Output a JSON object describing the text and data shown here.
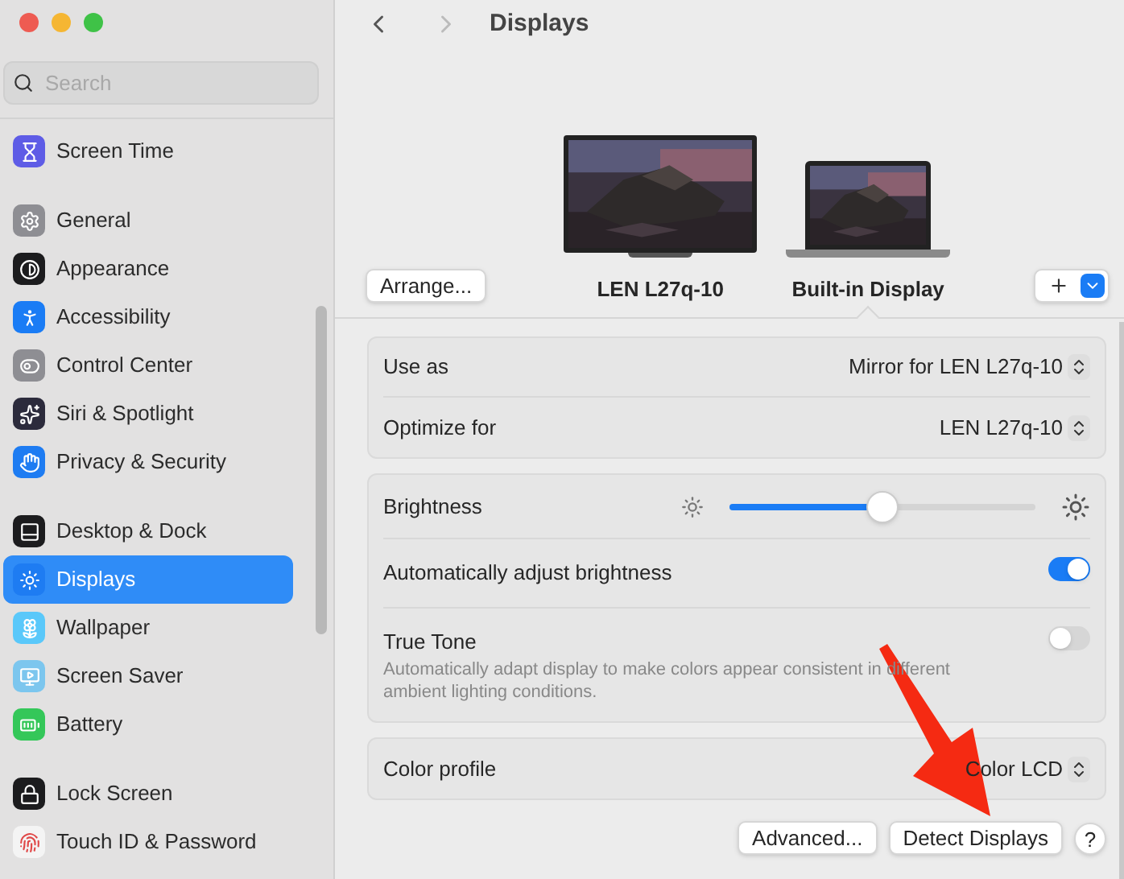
{
  "search": {
    "placeholder": "Search"
  },
  "sidebar": {
    "groups": [
      {
        "items": [
          {
            "label": "Screen Time",
            "color": "#5e5ce6",
            "selected": false
          }
        ]
      },
      {
        "items": [
          {
            "label": "General",
            "color": "#8e8e93",
            "selected": false
          },
          {
            "label": "Appearance",
            "color": "#1c1c1e",
            "selected": false
          },
          {
            "label": "Accessibility",
            "color": "#1a7cf5",
            "selected": false
          },
          {
            "label": "Control Center",
            "color": "#8e8e93",
            "selected": false
          },
          {
            "label": "Siri & Spotlight",
            "color": "#2c2b3c",
            "selected": false
          },
          {
            "label": "Privacy & Security",
            "color": "#1e7cf2",
            "selected": false
          }
        ]
      },
      {
        "items": [
          {
            "label": "Desktop & Dock",
            "color": "#1c1c1e",
            "selected": false
          },
          {
            "label": "Displays",
            "color": "#1e7cf2",
            "selected": true
          },
          {
            "label": "Wallpaper",
            "color": "#5ac8fa",
            "selected": false
          },
          {
            "label": "Screen Saver",
            "color": "#7cc6ee",
            "selected": false
          },
          {
            "label": "Battery",
            "color": "#34c759",
            "selected": false
          }
        ]
      },
      {
        "items": [
          {
            "label": "Lock Screen",
            "color": "#1c1c1e",
            "selected": false
          },
          {
            "label": "Touch ID & Password",
            "color": "#f4f4f4",
            "selected": false
          }
        ]
      }
    ]
  },
  "toolbar": {
    "back_disabled": false,
    "forward_disabled": true,
    "title": "Displays"
  },
  "arrange_button": "Arrange...",
  "displays": [
    {
      "kind": "monitor",
      "label": "LEN L27q-10",
      "selected": false
    },
    {
      "kind": "laptop",
      "label": "Built-in Display",
      "selected": true
    }
  ],
  "settings_groups": [
    {
      "rows": [
        {
          "kind": "popup",
          "label": "Use as",
          "value": "Mirror for LEN L27q-10"
        },
        {
          "kind": "popup",
          "label": "Optimize for",
          "value": "LEN L27q-10"
        }
      ]
    },
    {
      "rows": [
        {
          "kind": "slider",
          "label": "Brightness",
          "level": 0.5
        },
        {
          "kind": "toggle",
          "label": "Automatically adjust brightness",
          "on": true
        },
        {
          "kind": "toggle",
          "label": "True Tone",
          "description": "Automatically adapt display to make colors appear consistent in different ambient lighting conditions.",
          "on": false
        }
      ]
    },
    {
      "rows": [
        {
          "kind": "popup",
          "label": "Color profile",
          "value": "Color LCD"
        }
      ]
    }
  ],
  "buttons": [
    "Advanced...",
    "Detect Displays"
  ],
  "help_button": "?"
}
